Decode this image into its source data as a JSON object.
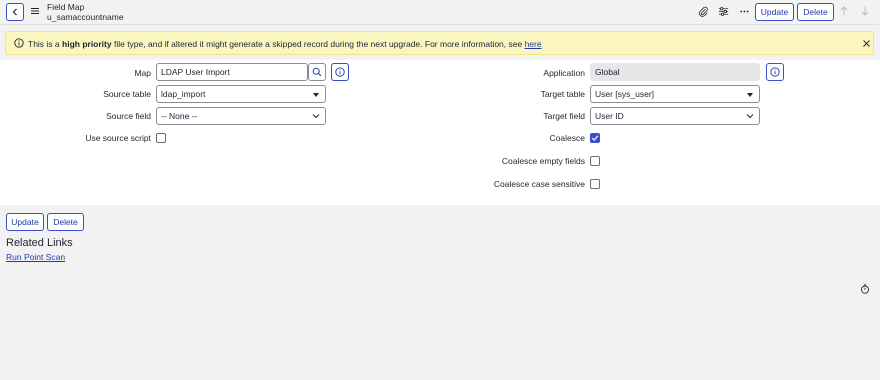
{
  "header": {
    "title": "Field Map",
    "subtitle": "u_samaccountname",
    "update_label": "Update",
    "delete_label": "Delete"
  },
  "banner": {
    "text_before": "This is a ",
    "text_bold": "high priority",
    "text_after": " file type, and if altered it might generate a skipped record during the next upgrade. For more information, see ",
    "link_text": "here"
  },
  "form": {
    "map": {
      "label": "Map",
      "value": "LDAP User Import"
    },
    "source_table": {
      "label": "Source table",
      "value": "ldap_import"
    },
    "source_field": {
      "label": "Source field",
      "value": "-- None --"
    },
    "use_source_script": {
      "label": "Use source script",
      "checked": false
    },
    "application": {
      "label": "Application",
      "value": "Global"
    },
    "target_table": {
      "label": "Target table",
      "value": "User [sys_user]"
    },
    "target_field": {
      "label": "Target field",
      "value": "User ID"
    },
    "coalesce": {
      "label": "Coalesce",
      "checked": true
    },
    "coalesce_empty_fields": {
      "label": "Coalesce empty fields",
      "checked": false
    },
    "coalesce_case_sensitive": {
      "label": "Coalesce case sensitive",
      "checked": false
    }
  },
  "footer": {
    "update_label": "Update",
    "delete_label": "Delete"
  },
  "related_links": {
    "heading": "Related Links",
    "items": [
      "Run Point Scan"
    ]
  },
  "colors": {
    "accent": "#3a4fc9",
    "banner_bg": "#fbf6bf",
    "page_bg": "#f2f2f3"
  }
}
